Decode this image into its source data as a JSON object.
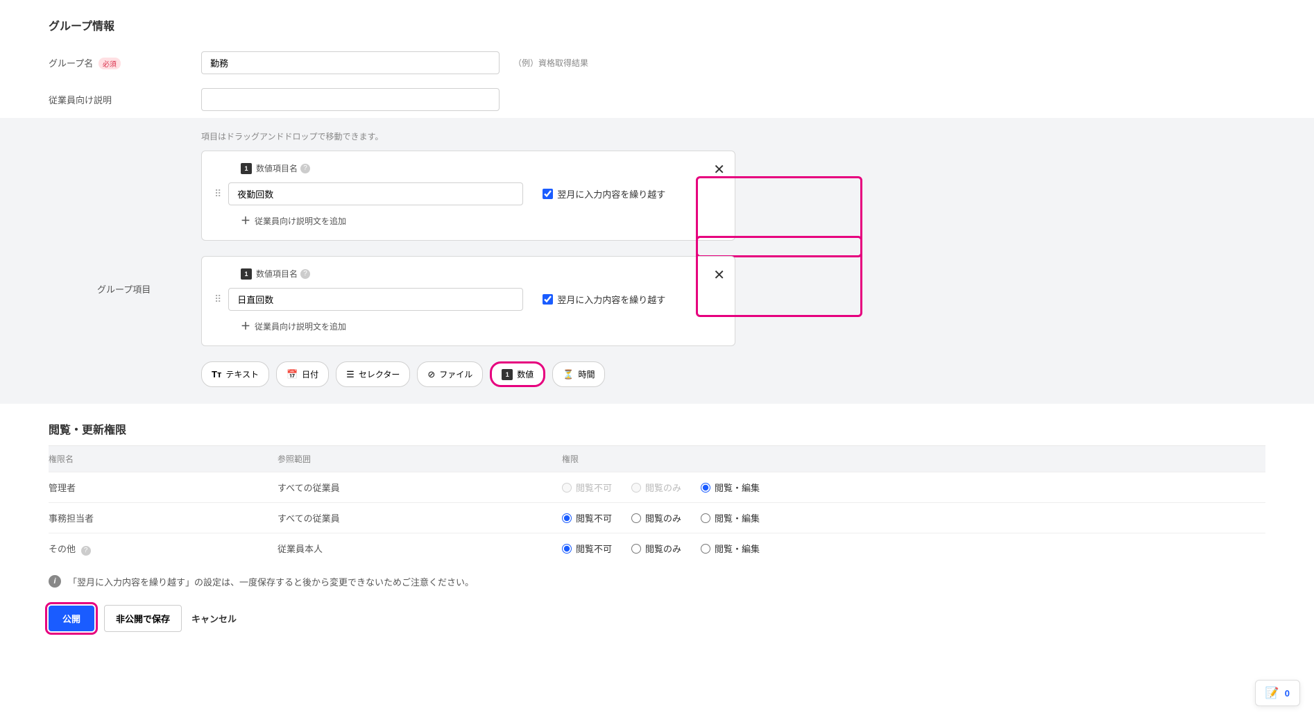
{
  "section_group_info": {
    "title": "グループ情報",
    "group_name_label": "グループ名",
    "group_name_value": "勤務",
    "group_name_required": "必須",
    "group_name_example": "（例）資格取得結果",
    "description_label": "従業員向け説明",
    "description_value": ""
  },
  "items_section": {
    "hint": "項目はドラッグアンドドロップで移動できます。",
    "group_items_label": "グループ項目",
    "item_type_label": "数値項目名",
    "carry_over_label": "翌月に入力内容を繰り越す",
    "add_description_label": "従業員向け説明文を追加",
    "items": [
      {
        "name": "夜勤回数",
        "carry_over": true
      },
      {
        "name": "日直回数",
        "carry_over": true
      }
    ],
    "type_buttons": [
      {
        "icon": "Tт",
        "label": "テキスト"
      },
      {
        "icon": "cal",
        "label": "日付"
      },
      {
        "icon": "list",
        "label": "セレクター"
      },
      {
        "icon": "link",
        "label": "ファイル"
      },
      {
        "icon": "num",
        "label": "数値"
      },
      {
        "icon": "hourglass",
        "label": "時間"
      }
    ]
  },
  "permissions": {
    "title": "閲覧・更新権限",
    "headers": {
      "name": "権限名",
      "scope": "参照範囲",
      "perm": "権限"
    },
    "options": {
      "no_view": "閲覧不可",
      "view_only": "閲覧のみ",
      "view_edit": "閲覧・編集"
    },
    "rows": [
      {
        "name": "管理者",
        "scope": "すべての従業員",
        "selected": "view_edit",
        "disabled": [
          "no_view",
          "view_only"
        ]
      },
      {
        "name": "事務担当者",
        "scope": "すべての従業員",
        "selected": "no_view",
        "disabled": []
      },
      {
        "name": "その他",
        "scope": "従業員本人",
        "selected": "no_view",
        "disabled": [],
        "help": true
      }
    ]
  },
  "info_note": "「翌月に入力内容を繰り越す」の設定は、一度保存すると後から変更できないためご注意ください。",
  "actions": {
    "publish": "公開",
    "save_private": "非公開で保存",
    "cancel": "キャンセル"
  },
  "float_count": "0"
}
